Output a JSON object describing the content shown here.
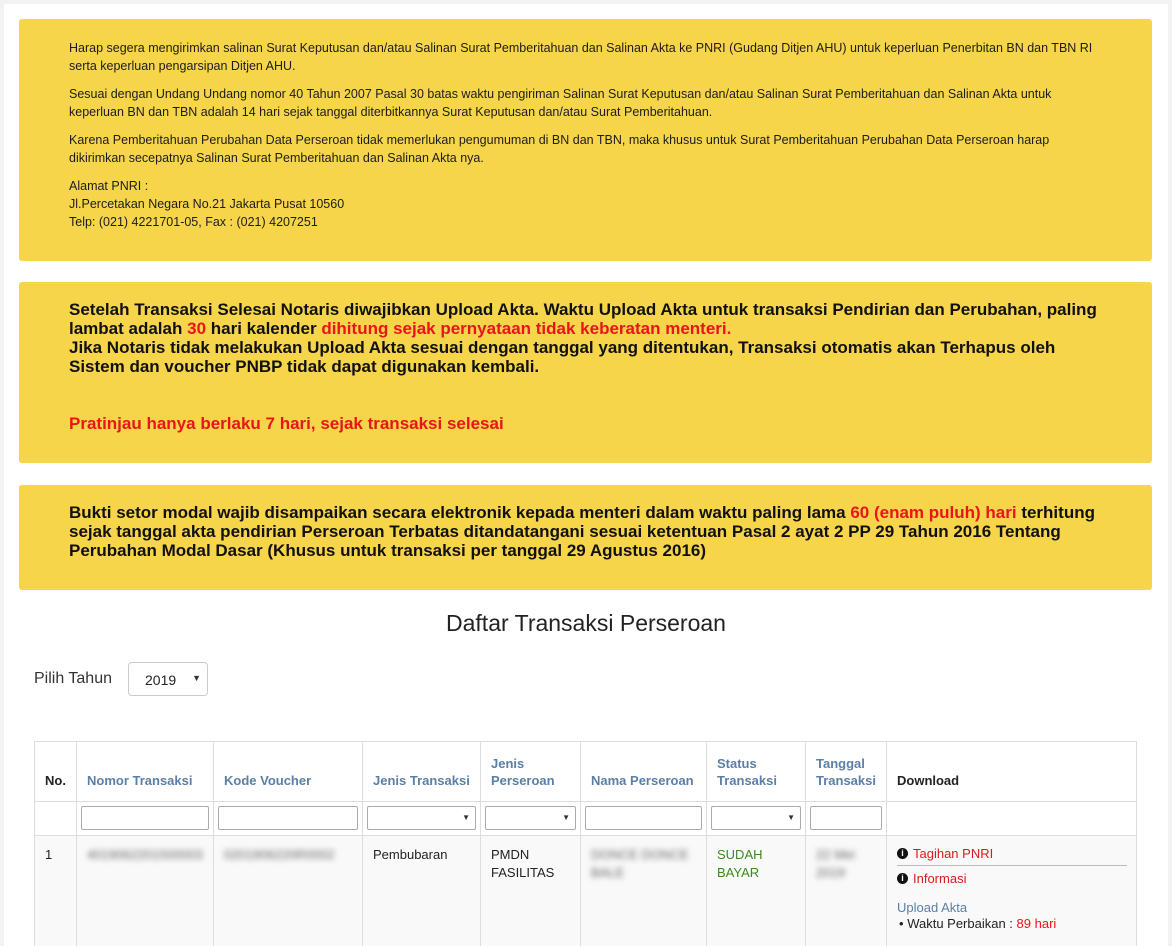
{
  "notice_pnri": {
    "para1": "Harap segera mengirimkan salinan Surat Keputusan dan/atau Salinan Surat Pemberitahuan dan Salinan Akta ke PNRI (Gudang Ditjen AHU) untuk keperluan Penerbitan BN dan TBN RI serta keperluan pengarsipan Ditjen AHU.",
    "para2": "Sesuai dengan Undang Undang nomor 40 Tahun 2007 Pasal 30 batas waktu pengiriman Salinan Surat Keputusan dan/atau Salinan Surat Pemberitahuan dan Salinan Akta untuk keperluan BN dan TBN adalah 14 hari sejak tanggal diterbitkannya Surat Keputusan dan/atau Surat Pemberitahuan.",
    "para3": "Karena Pemberitahuan Perubahan Data Perseroan tidak memerlukan pengumuman di BN dan TBN, maka khusus untuk Surat Pemberitahuan Perubahan Data Perseroan harap dikirimkan secepatnya Salinan Surat Pemberitahuan dan Salinan Akta nya.",
    "address_label": "Alamat PNRI :",
    "address_line": "Jl.Percetakan Negara No.21 Jakarta Pusat 10560",
    "phone_line": "Telp: (021) 4221701-05, Fax : (021) 4207251"
  },
  "notice_upload": {
    "part1": "Setelah Transaksi Selesai Notaris diwajibkan Upload Akta. Waktu Upload Akta untuk transaksi Pendirian dan Perubahan, paling lambat adalah ",
    "days": "30",
    "part2": " hari kalender ",
    "part3": "dihitung sejak pernyataan tidak keberatan menteri.",
    "part4": "Jika Notaris tidak melakukan Upload Akta sesuai dengan tanggal yang ditentukan, Transaksi otomatis akan Terhapus oleh Sistem dan voucher PNBP tidak dapat digunakan kembali.",
    "preview": "Pratinjau hanya berlaku 7 hari, sejak transaksi selesai"
  },
  "notice_modal": {
    "part1": "Bukti setor modal wajib disampaikan secara elektronik kepada menteri dalam waktu paling lama ",
    "days": "60 (enam puluh) hari",
    "part2": " terhitung sejak tanggal akta pendirian Perseroan Terbatas ditandatangani sesuai ketentuan Pasal 2 ayat 2 PP 29 Tahun 2016 Tentang Perubahan Modal Dasar (Khusus untuk transaksi per tanggal 29 Agustus 2016)"
  },
  "page_title": "Daftar Transaksi Perseroan",
  "year_filter": {
    "label": "Pilih Tahun",
    "selected": "2019"
  },
  "table": {
    "headers": {
      "no": "No.",
      "nomor_transaksi": "Nomor Transaksi",
      "kode_voucher": "Kode Voucher",
      "jenis_transaksi": "Jenis Transaksi",
      "jenis_perseroan_1": "Jenis",
      "jenis_perseroan_2": "Perseroan",
      "nama_perseroan": "Nama Perseroan",
      "status_1": "Status",
      "status_2": "Transaksi",
      "tanggal_1": "Tanggal",
      "tanggal_2": "Transaksi",
      "download": "Download"
    },
    "rows": [
      {
        "no": "1",
        "nomor_transaksi": "4019062201500003",
        "kode_voucher": "0201906220R0002",
        "jenis_transaksi": "Pembubaran",
        "jenis_perseroan_1": "PMDN",
        "jenis_perseroan_2": "FASILITAS",
        "nama_perseroan_1": "DONCE DONCE",
        "nama_perseroan_2": "BALE",
        "status_1": "SUDAH",
        "status_2": "BAYAR",
        "tanggal_1": "22 Mei",
        "tanggal_2": "2019",
        "download": {
          "tagihan": "Tagihan PNRI",
          "informasi": "Informasi",
          "upload_title": "Upload Akta",
          "waktu_label": "Waktu Perbaikan : ",
          "waktu_value": "89 hari"
        }
      }
    ]
  },
  "colors": {
    "notice_bg": "#f7d54b",
    "alert_red": "#e8151b",
    "header_blue": "#5b7fa6",
    "status_green": "#3a8a1e"
  }
}
